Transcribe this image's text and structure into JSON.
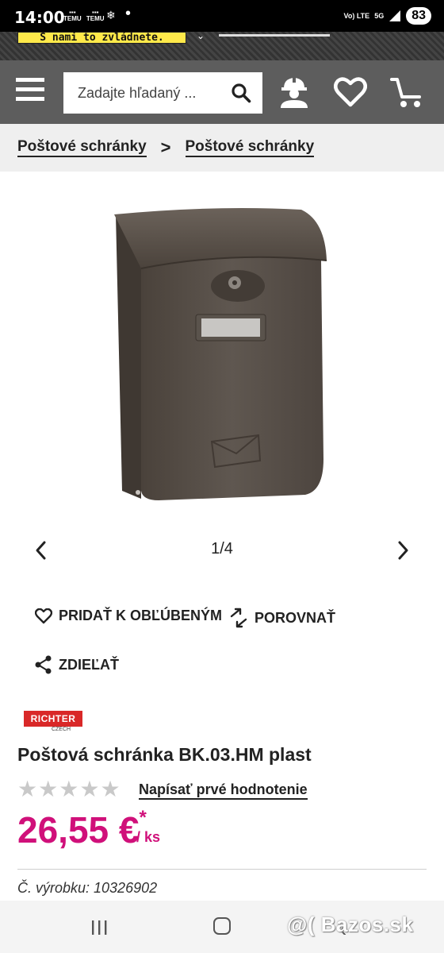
{
  "status_bar": {
    "time": "14:00",
    "app_labels": [
      "TEMU",
      "TEMU"
    ],
    "network_volte": "Vo) LTE",
    "network_5g": "5G",
    "battery": "83"
  },
  "promo": {
    "text": "S nami to zvládnete."
  },
  "header": {
    "search_placeholder": "Zadajte hľadaný ..."
  },
  "breadcrumb": {
    "items": [
      {
        "label": "Poštové schránky"
      },
      {
        "label": "Poštové schránky"
      }
    ],
    "separator": ">"
  },
  "gallery": {
    "counter": "1/4"
  },
  "actions": {
    "favorite": "PRIDAŤ K OBĽÚBENÝM",
    "compare": "POROVNAŤ",
    "share": "ZDIEĽAŤ"
  },
  "product": {
    "brand": "RICHTER",
    "brand_sub": "CZECH",
    "title": "Poštová schránka BK.03.HM plast",
    "rating_stars": 0,
    "rating_max": 5,
    "rating_link": "Napísať prvé hodnotenie",
    "price": "26,55 €",
    "price_asterisk": "*",
    "price_unit": "/ ks",
    "sku": "Č. výrobku: 10326902"
  },
  "watermark": "@( Bazos.sk",
  "colors": {
    "header_bg": "#5d5d5d",
    "price": "#d0107a",
    "brand_red": "#d92828",
    "promo_yellow": "#ffe94a"
  }
}
